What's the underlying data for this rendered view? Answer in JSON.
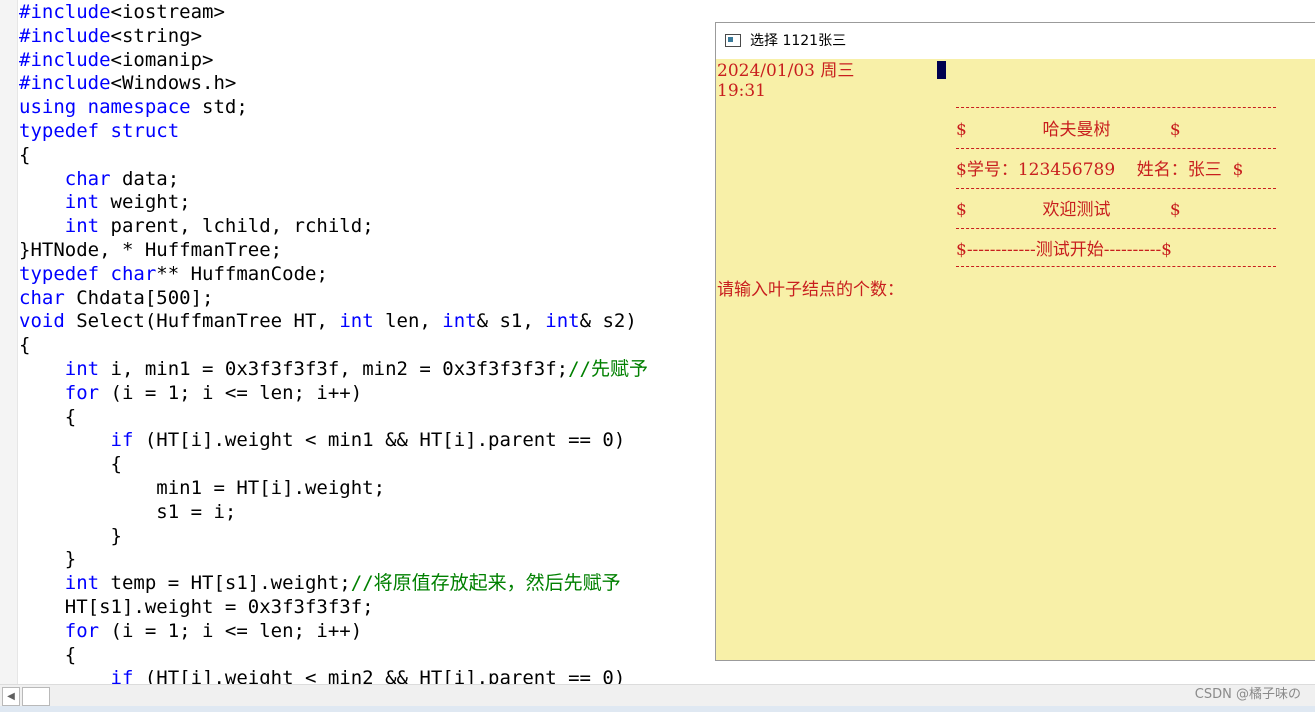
{
  "editor": {
    "lines": [
      [
        {
          "t": "#include",
          "c": "pp"
        },
        {
          "t": "<iostream>"
        }
      ],
      [
        {
          "t": "#include",
          "c": "pp"
        },
        {
          "t": "<string>"
        }
      ],
      [
        {
          "t": "#include",
          "c": "pp"
        },
        {
          "t": "<iomanip>"
        }
      ],
      [
        {
          "t": "#include",
          "c": "pp"
        },
        {
          "t": "<Windows.h>"
        }
      ],
      [
        {
          "t": "using",
          "c": "kw"
        },
        {
          "t": " "
        },
        {
          "t": "namespace",
          "c": "kw"
        },
        {
          "t": " std;"
        }
      ],
      [
        {
          "t": "typedef",
          "c": "kw"
        },
        {
          "t": " "
        },
        {
          "t": "struct",
          "c": "kw"
        }
      ],
      [
        {
          "t": "{"
        }
      ],
      [
        {
          "t": "    "
        },
        {
          "t": "char",
          "c": "kw"
        },
        {
          "t": " data;"
        }
      ],
      [
        {
          "t": "    "
        },
        {
          "t": "int",
          "c": "kw"
        },
        {
          "t": " weight;"
        }
      ],
      [
        {
          "t": "    "
        },
        {
          "t": "int",
          "c": "kw"
        },
        {
          "t": " parent, lchild, rchild;"
        }
      ],
      [
        {
          "t": "}HTNode, * HuffmanTree;"
        }
      ],
      [
        {
          "t": "typedef",
          "c": "kw"
        },
        {
          "t": " "
        },
        {
          "t": "char",
          "c": "kw"
        },
        {
          "t": "** HuffmanCode;"
        }
      ],
      [
        {
          "t": "char",
          "c": "kw"
        },
        {
          "t": " Chdata[500];"
        }
      ],
      [
        {
          "t": "void",
          "c": "kw"
        },
        {
          "t": " Select(HuffmanTree HT, "
        },
        {
          "t": "int",
          "c": "kw"
        },
        {
          "t": " len, "
        },
        {
          "t": "int",
          "c": "kw"
        },
        {
          "t": "& s1, "
        },
        {
          "t": "int",
          "c": "kw"
        },
        {
          "t": "& s2)"
        }
      ],
      [
        {
          "t": "{"
        }
      ],
      [
        {
          "t": "    "
        },
        {
          "t": "int",
          "c": "kw"
        },
        {
          "t": " i, min1 = 0x3f3f3f3f, min2 = 0x3f3f3f3f;"
        },
        {
          "t": "//先赋予",
          "c": "cm"
        }
      ],
      [
        {
          "t": "    "
        },
        {
          "t": "for",
          "c": "kw"
        },
        {
          "t": " (i = 1; i <= len; i++)"
        }
      ],
      [
        {
          "t": "    {"
        }
      ],
      [
        {
          "t": "        "
        },
        {
          "t": "if",
          "c": "kw"
        },
        {
          "t": " (HT[i].weight < min1 && HT[i].parent == 0)"
        }
      ],
      [
        {
          "t": "        {"
        }
      ],
      [
        {
          "t": "            min1 = HT[i].weight;"
        }
      ],
      [
        {
          "t": "            s1 = i;"
        }
      ],
      [
        {
          "t": "        }"
        }
      ],
      [
        {
          "t": "    }"
        }
      ],
      [
        {
          "t": "    "
        },
        {
          "t": "int",
          "c": "kw"
        },
        {
          "t": " temp = HT[s1].weight;"
        },
        {
          "t": "//将原值存放起来，然后先赋予",
          "c": "cm"
        }
      ],
      [
        {
          "t": "    HT[s1].weight = 0x3f3f3f3f;"
        }
      ],
      [
        {
          "t": "    "
        },
        {
          "t": "for",
          "c": "kw"
        },
        {
          "t": " (i = 1; i <= len; i++)"
        }
      ],
      [
        {
          "t": "    {"
        }
      ],
      [
        {
          "t": "        "
        },
        {
          "t": "if",
          "c": "kw"
        },
        {
          "t": " (HT[i].weight < min2 && HT[i].parent == 0)"
        }
      ]
    ]
  },
  "console": {
    "title": "选择 1121张三",
    "date_line": "2024/01/03 周三",
    "time_line": "19:31",
    "menu_title": "$              哈夫曼树           $",
    "student_info": "$学号：123456789    姓名：张三  $",
    "welcome": "$              欢迎测试           $",
    "start": "$------------测试开始----------$",
    "prompt": "请输入叶子结点的个数："
  },
  "scrollbar": {
    "left_arrow": "◀"
  },
  "watermark": "CSDN @橘子味の"
}
